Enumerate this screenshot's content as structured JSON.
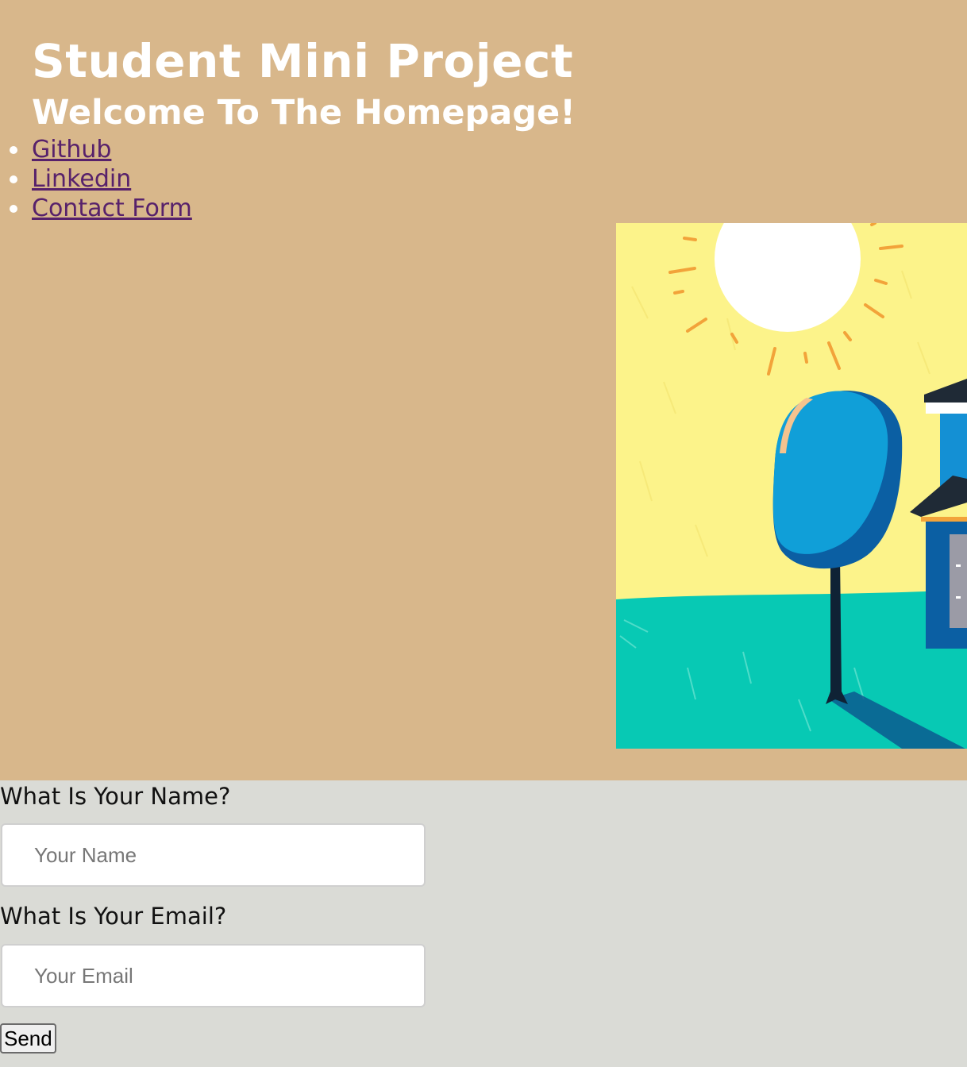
{
  "header": {
    "title": "Student Mini Project",
    "subtitle": "Welcome To The Homepage!"
  },
  "nav": {
    "items": [
      {
        "label": "Github"
      },
      {
        "label": "Linkedin"
      },
      {
        "label": "Contact Form"
      }
    ]
  },
  "illustration": {
    "icon": "sunny-landscape-illustration",
    "colors": {
      "sky": "#fcf38a",
      "sun": "#ffffff",
      "rays": "#f2a33a",
      "ground": "#07c9b4",
      "tree": "#109fd8",
      "tree_shade": "#0b5fa3",
      "house": "#1490d4"
    }
  },
  "form": {
    "name_label": "What Is Your Name?",
    "name_placeholder": "Your Name",
    "email_label": "What Is Your Email?",
    "email_placeholder": "Your Email",
    "send_label": "Send"
  },
  "colors": {
    "hero_background": "#d8b78b",
    "form_background": "#dadbd6",
    "link": "#57216b",
    "heading": "#ffffff"
  }
}
